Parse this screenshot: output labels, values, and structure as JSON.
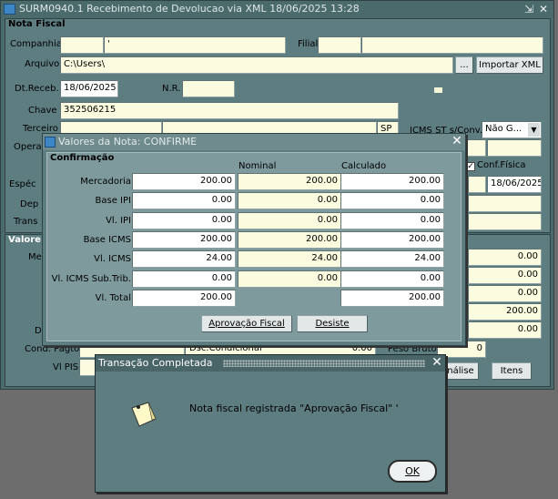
{
  "main_window": {
    "title": "SURM0940.1   Recebimento de Devolucao via XML    18/06/2025 13:28",
    "minimize_glyph": "⇲",
    "close_glyph": "✕"
  },
  "nota_fiscal": {
    "group_title": "Nota Fiscal",
    "companhia_label": "Companhia",
    "companhia_value": "",
    "companhia_desc": "'",
    "filial_label": "Filial",
    "filial_value": "",
    "filial_desc": "",
    "arquivo_label": "Arquivo",
    "arquivo_value": "C:\\Users\\",
    "browse_label": "...",
    "importar_label": "Importar XML",
    "dt_receb_label": "Dt.Receb.",
    "dt_receb_value": "18/06/2025",
    "nr_label": "N.R.",
    "nr_value": "",
    "chave_label": "Chave",
    "chave_value": "352506215",
    "terceiro_label": "Terceiro",
    "terceiro_uf": "SP",
    "icms_st_label": "ICMS ST s/Conv.",
    "icms_st_value": "Não G...",
    "operacao_label": "Opera",
    "especie_label": "Espéc",
    "dep_label": "Dep",
    "trans_label": "Trans",
    "conf_fisica_label": "Conf.Física",
    "conf_fisica_checked": "✓",
    "date2_value": "18/06/2025"
  },
  "valores": {
    "group_title": "Valore",
    "me_label": "Me",
    "d_label": "D",
    "right_values": [
      "0.00",
      "0.00",
      "0.00",
      "200.00",
      "0.00"
    ],
    "cond_pagto_label": "Cond. Pagto",
    "dsc_condicional_label": "Dsc.Condicional",
    "dsc_condicional_value": "0.00",
    "peso_bruto_label": "Peso Bruto",
    "peso_bruto_value": "0",
    "vl_pis_label": "Vl PIS",
    "analise_label": "nálise",
    "itens_label": "Itens"
  },
  "confirm_dialog": {
    "title": "Valores da Nota: CONFIRME",
    "close_glyph": "✕",
    "group_title": "Confirmação",
    "col_nominal": "Nominal",
    "col_calculado": "Calculado",
    "rows": [
      {
        "label": "Mercadoria",
        "a": "200.00",
        "b": "200.00",
        "c": "200.00"
      },
      {
        "label": "Base IPI",
        "a": "0.00",
        "b": "0.00",
        "c": "0.00"
      },
      {
        "label": "Vl. IPI",
        "a": "0.00",
        "b": "0.00",
        "c": "0.00"
      },
      {
        "label": "Base ICMS",
        "a": "200.00",
        "b": "200.00",
        "c": "200.00"
      },
      {
        "label": "Vl. ICMS",
        "a": "24.00",
        "b": "24.00",
        "c": "24.00"
      },
      {
        "label": "Vl. ICMS Sub.Trib.",
        "a": "0.00",
        "b": "0.00",
        "c": "0.00"
      },
      {
        "label": "Vl. Total",
        "a": "200.00",
        "b": "",
        "c": "200.00"
      }
    ],
    "aprovacao_button": "Aprovação Fiscal",
    "desiste_button": "Desiste"
  },
  "completed_dialog": {
    "title": "Transação Completada",
    "close_glyph": "✕",
    "message": "Nota fiscal registrada \"Aprovação Fiscal\" '",
    "ok_button": "OK"
  }
}
